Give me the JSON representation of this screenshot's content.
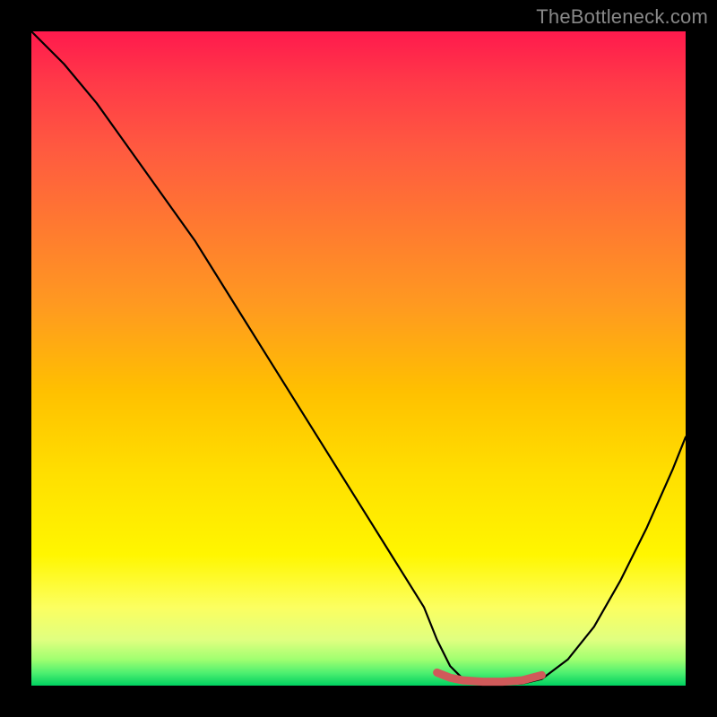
{
  "watermark": "TheBottleneck.com",
  "chart_data": {
    "type": "line",
    "title": "",
    "xlabel": "",
    "ylabel": "",
    "xlim": [
      0,
      100
    ],
    "ylim": [
      0,
      100
    ],
    "series": [
      {
        "name": "bottleneck-curve",
        "x": [
          0,
          5,
          10,
          15,
          20,
          25,
          30,
          35,
          40,
          45,
          50,
          55,
          60,
          62,
          64,
          66,
          69,
          72,
          75,
          78,
          82,
          86,
          90,
          94,
          98,
          100
        ],
        "values": [
          100,
          95,
          89,
          82,
          75,
          68,
          60,
          52,
          44,
          36,
          28,
          20,
          12,
          7,
          3,
          1,
          0.3,
          0.2,
          0.3,
          1,
          4,
          9,
          16,
          24,
          33,
          38
        ]
      },
      {
        "name": "optimal-band",
        "x": [
          62,
          64,
          66,
          69,
          72,
          75,
          78
        ],
        "values": [
          2.0,
          1.2,
          0.8,
          0.6,
          0.6,
          0.8,
          1.6
        ]
      }
    ],
    "annotations": []
  },
  "colors": {
    "curve": "#000000",
    "band": "#d05a5a",
    "background_top": "#ff1a4d",
    "background_bottom": "#00d060"
  }
}
